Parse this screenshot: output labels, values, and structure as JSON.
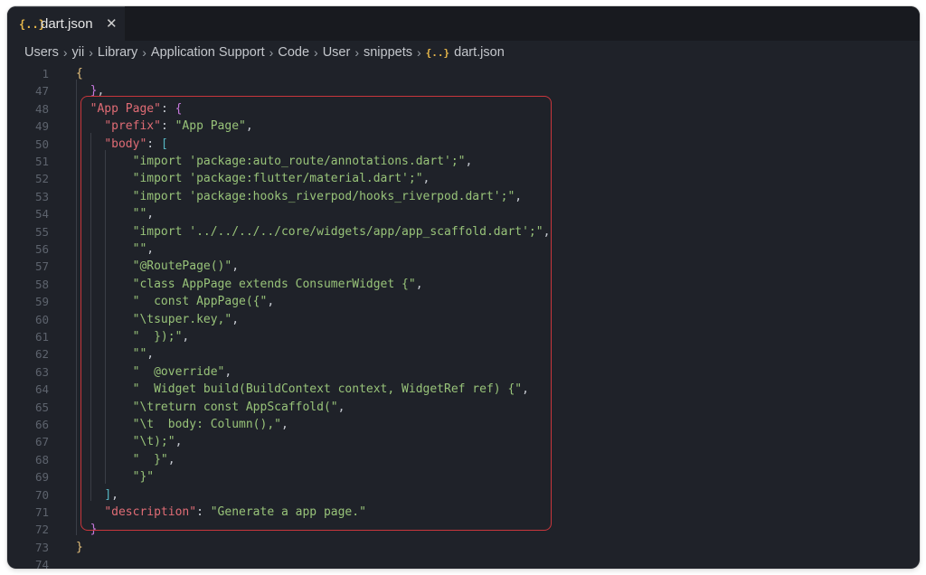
{
  "tab": {
    "icon": "{..}",
    "label": "dart.json",
    "close": "✕"
  },
  "breadcrumb": [
    "Users",
    "yii",
    "Library",
    "Application Support",
    "Code",
    "User",
    "snippets"
  ],
  "breadcrumb_file": {
    "icon": "{..}",
    "label": "dart.json"
  },
  "lines": [
    {
      "num": "1",
      "parts": [
        [
          "b1",
          "{"
        ]
      ]
    },
    {
      "num": "47",
      "parts": [
        [
          "p",
          "  "
        ],
        [
          "b2",
          "}"
        ],
        [
          "p",
          ","
        ]
      ]
    },
    {
      "num": "48",
      "parts": [
        [
          "p",
          "  "
        ],
        [
          "k",
          "\"App Page\""
        ],
        [
          "p",
          ": "
        ],
        [
          "b2",
          "{"
        ]
      ]
    },
    {
      "num": "49",
      "parts": [
        [
          "p",
          "    "
        ],
        [
          "k",
          "\"prefix\""
        ],
        [
          "p",
          ": "
        ],
        [
          "s",
          "\"App Page\""
        ],
        [
          "p",
          ","
        ]
      ]
    },
    {
      "num": "50",
      "parts": [
        [
          "p",
          "    "
        ],
        [
          "k",
          "\"body\""
        ],
        [
          "p",
          ": "
        ],
        [
          "b3",
          "["
        ]
      ]
    },
    {
      "num": "51",
      "parts": [
        [
          "p",
          "        "
        ],
        [
          "s",
          "\"import 'package:auto_route/annotations.dart';\""
        ],
        [
          "p",
          ","
        ]
      ]
    },
    {
      "num": "52",
      "parts": [
        [
          "p",
          "        "
        ],
        [
          "s",
          "\"import 'package:flutter/material.dart';\""
        ],
        [
          "p",
          ","
        ]
      ]
    },
    {
      "num": "53",
      "parts": [
        [
          "p",
          "        "
        ],
        [
          "s",
          "\"import 'package:hooks_riverpod/hooks_riverpod.dart';\""
        ],
        [
          "p",
          ","
        ]
      ]
    },
    {
      "num": "54",
      "parts": [
        [
          "p",
          "        "
        ],
        [
          "s",
          "\"\""
        ],
        [
          "p",
          ","
        ]
      ]
    },
    {
      "num": "55",
      "parts": [
        [
          "p",
          "        "
        ],
        [
          "s",
          "\"import '../../../../core/widgets/app/app_scaffold.dart';\""
        ],
        [
          "p",
          ","
        ]
      ]
    },
    {
      "num": "56",
      "parts": [
        [
          "p",
          "        "
        ],
        [
          "s",
          "\"\""
        ],
        [
          "p",
          ","
        ]
      ]
    },
    {
      "num": "57",
      "parts": [
        [
          "p",
          "        "
        ],
        [
          "s",
          "\"@RoutePage()\""
        ],
        [
          "p",
          ","
        ]
      ]
    },
    {
      "num": "58",
      "parts": [
        [
          "p",
          "        "
        ],
        [
          "s",
          "\"class AppPage extends ConsumerWidget {\""
        ],
        [
          "p",
          ","
        ]
      ]
    },
    {
      "num": "59",
      "parts": [
        [
          "p",
          "        "
        ],
        [
          "s",
          "\"  const AppPage({\""
        ],
        [
          "p",
          ","
        ]
      ]
    },
    {
      "num": "60",
      "parts": [
        [
          "p",
          "        "
        ],
        [
          "s",
          "\"\\tsuper.key,\""
        ],
        [
          "p",
          ","
        ]
      ]
    },
    {
      "num": "61",
      "parts": [
        [
          "p",
          "        "
        ],
        [
          "s",
          "\"  });\""
        ],
        [
          "p",
          ","
        ]
      ]
    },
    {
      "num": "62",
      "parts": [
        [
          "p",
          "        "
        ],
        [
          "s",
          "\"\""
        ],
        [
          "p",
          ","
        ]
      ]
    },
    {
      "num": "63",
      "parts": [
        [
          "p",
          "        "
        ],
        [
          "s",
          "\"  @override\""
        ],
        [
          "p",
          ","
        ]
      ]
    },
    {
      "num": "64",
      "parts": [
        [
          "p",
          "        "
        ],
        [
          "s",
          "\"  Widget build(BuildContext context, WidgetRef ref) {\""
        ],
        [
          "p",
          ","
        ]
      ]
    },
    {
      "num": "65",
      "parts": [
        [
          "p",
          "        "
        ],
        [
          "s",
          "\"\\treturn const AppScaffold(\""
        ],
        [
          "p",
          ","
        ]
      ]
    },
    {
      "num": "66",
      "parts": [
        [
          "p",
          "        "
        ],
        [
          "s",
          "\"\\t  body: Column(),\""
        ],
        [
          "p",
          ","
        ]
      ]
    },
    {
      "num": "67",
      "parts": [
        [
          "p",
          "        "
        ],
        [
          "s",
          "\"\\t);\""
        ],
        [
          "p",
          ","
        ]
      ]
    },
    {
      "num": "68",
      "parts": [
        [
          "p",
          "        "
        ],
        [
          "s",
          "\"  }\""
        ],
        [
          "p",
          ","
        ]
      ]
    },
    {
      "num": "69",
      "parts": [
        [
          "p",
          "        "
        ],
        [
          "s",
          "\"}\""
        ]
      ]
    },
    {
      "num": "70",
      "parts": [
        [
          "p",
          "    "
        ],
        [
          "b3",
          "]"
        ],
        [
          "p",
          ","
        ]
      ]
    },
    {
      "num": "71",
      "parts": [
        [
          "p",
          "    "
        ],
        [
          "k",
          "\"description\""
        ],
        [
          "p",
          ": "
        ],
        [
          "s",
          "\"Generate a app page.\""
        ]
      ]
    },
    {
      "num": "72",
      "parts": [
        [
          "p",
          "  "
        ],
        [
          "b2",
          "}"
        ]
      ]
    },
    {
      "num": "73",
      "parts": [
        [
          "b1",
          "}"
        ]
      ]
    },
    {
      "num": "74",
      "parts": []
    }
  ],
  "colors": {
    "editor_bg": "#1f2229",
    "key": "#e06c75",
    "string": "#98c379",
    "highlight_border": "#c8363c",
    "json_icon": "#e8b84a"
  }
}
